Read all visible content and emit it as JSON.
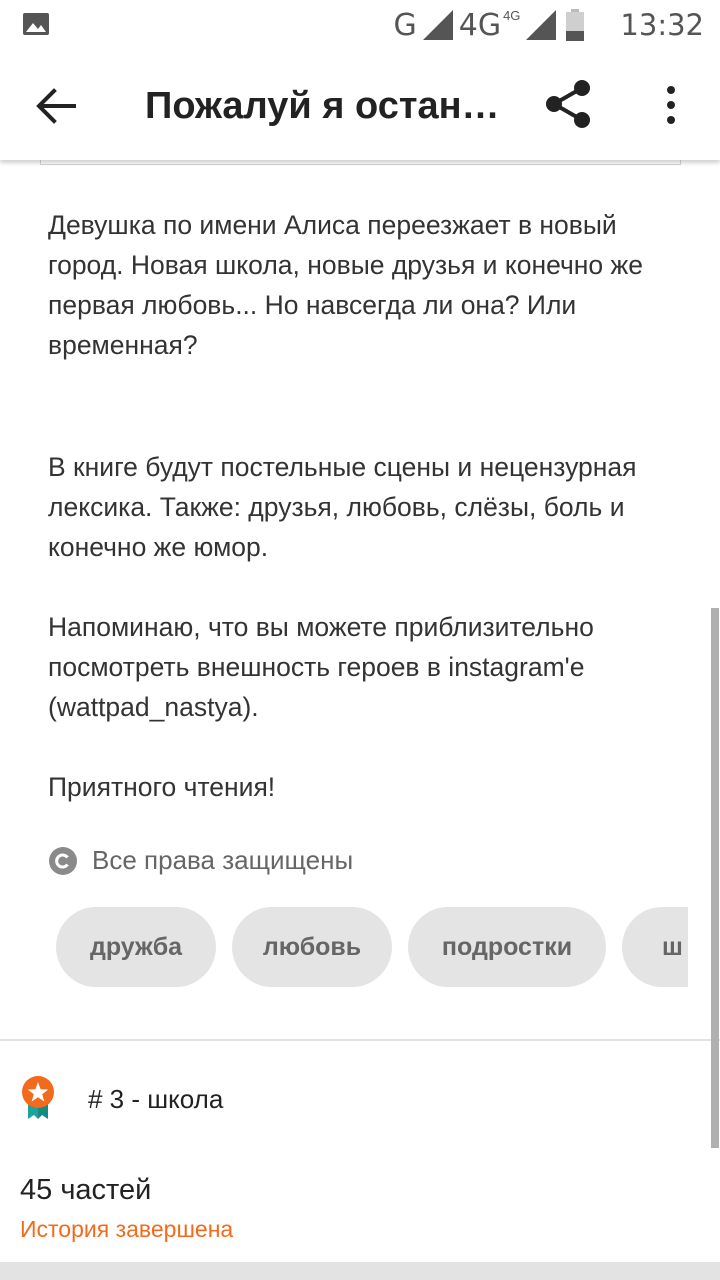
{
  "status_bar": {
    "network_g": "G",
    "network_4g": "4G",
    "network_4g_sup": "4G",
    "time": "13:32",
    "icons": [
      "image-icon",
      "signal-icon",
      "signal-icon",
      "battery-icon"
    ]
  },
  "app_bar": {
    "title": "Пожалуй я остан…",
    "icons": [
      "back-arrow-icon",
      "share-icon",
      "more-vert-icon"
    ]
  },
  "description": {
    "p1": "Девушка по имени Алиса переезжает в новый город. Новая школа, новые друзья и конечно же первая любовь... Но навсегда ли она? Или временная?",
    "p2": "В книге будут постельные сцены и нецензурная лексика. Также: друзья, любовь, слёзы, боль и конечно же юмор.",
    "p3": "Напоминаю, что вы можете приблизительно посмотреть внешность героев в instagram'e (wattpad_nastya).",
    "p4": "Приятного чтения!"
  },
  "copyright": {
    "icon": "copyright-icon",
    "text": "Все права защищены"
  },
  "tags": [
    "дружба",
    "любовь",
    "подростки",
    "ш"
  ],
  "ranking": {
    "icon": "rank-badge-icon",
    "text": "# 3 - школа"
  },
  "story_info": {
    "parts": "45 частей",
    "status": "История завершена"
  },
  "colors": {
    "accent": "#f26b1d",
    "tag_bg": "#e4e4e4",
    "text": "#222222"
  }
}
